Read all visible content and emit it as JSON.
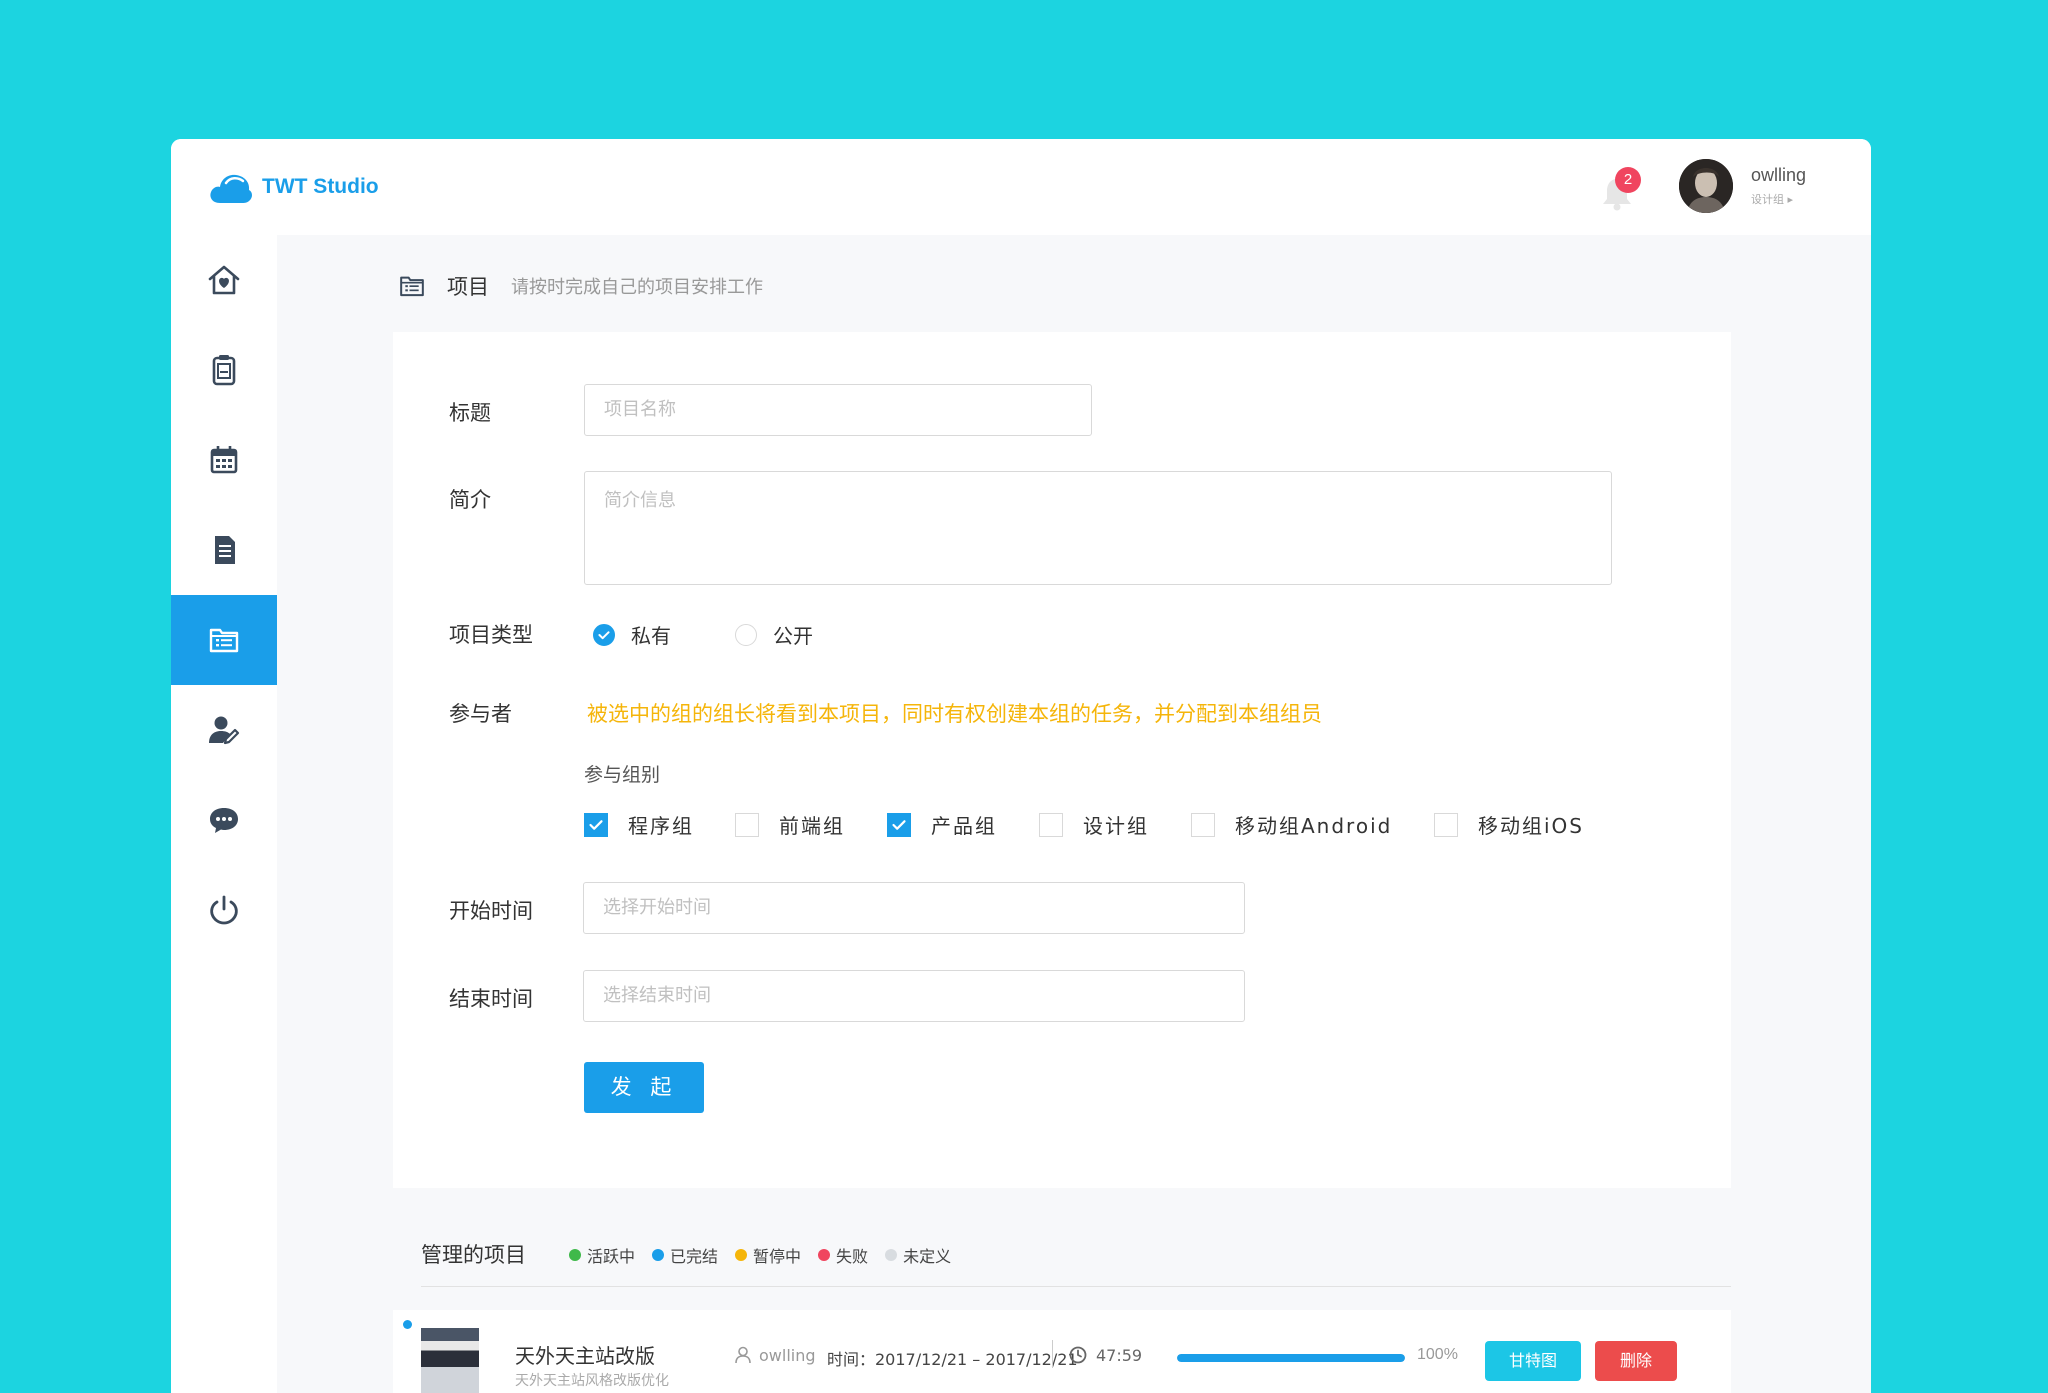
{
  "brand": {
    "name": "TWT Studio"
  },
  "header": {
    "notification_count": "2",
    "user_name": "owlling",
    "user_group": "设计组 ▸"
  },
  "sidebar": {
    "items": [
      {
        "icon": "home-icon"
      },
      {
        "icon": "clipboard-icon"
      },
      {
        "icon": "calendar-icon"
      },
      {
        "icon": "document-icon"
      },
      {
        "icon": "project-list-icon",
        "active": true
      },
      {
        "icon": "user-edit-icon"
      },
      {
        "icon": "chat-icon"
      },
      {
        "icon": "power-icon"
      }
    ]
  },
  "page": {
    "title": "项目",
    "subtitle": "请按时完成自己的项目安排工作"
  },
  "form": {
    "title_label": "标题",
    "title_placeholder": "项目名称",
    "intro_label": "简介",
    "intro_placeholder": "简介信息",
    "type_label": "项目类型",
    "type_options": [
      {
        "label": "私有",
        "selected": true
      },
      {
        "label": "公开",
        "selected": false
      }
    ],
    "participants_label": "参与者",
    "participants_notice": "被选中的组的组长将看到本项目，同时有权创建本组的任务，并分配到本组组员",
    "groups_title": "参与组别",
    "groups": [
      {
        "label": "程序组",
        "checked": true
      },
      {
        "label": "前端组",
        "checked": false
      },
      {
        "label": "产品组",
        "checked": true
      },
      {
        "label": "设计组",
        "checked": false
      },
      {
        "label": "移动组Android",
        "checked": false
      },
      {
        "label": "移动组iOS",
        "checked": false
      }
    ],
    "start_label": "开始时间",
    "start_placeholder": "选择开始时间",
    "end_label": "结束时间",
    "end_placeholder": "选择结束时间",
    "submit_label": "发 起"
  },
  "managed": {
    "title": "管理的项目",
    "legend": [
      {
        "label": "活跃中",
        "color": "#3fb94a"
      },
      {
        "label": "已完结",
        "color": "#1a9ee9"
      },
      {
        "label": "暂停中",
        "color": "#f5b50a"
      },
      {
        "label": "失败",
        "color": "#f0455f"
      },
      {
        "label": "未定义",
        "color": "#d8dce0"
      }
    ],
    "projects": [
      {
        "name": "天外天主站改版",
        "desc": "天外天主站风格改版优化",
        "owner": "owlling",
        "time": "时间：2017/12/21 – 2017/12/21",
        "duration": "47:59",
        "progress": 100,
        "progress_text": "100%",
        "gantt_label": "甘特图",
        "delete_label": "删除"
      }
    ]
  }
}
